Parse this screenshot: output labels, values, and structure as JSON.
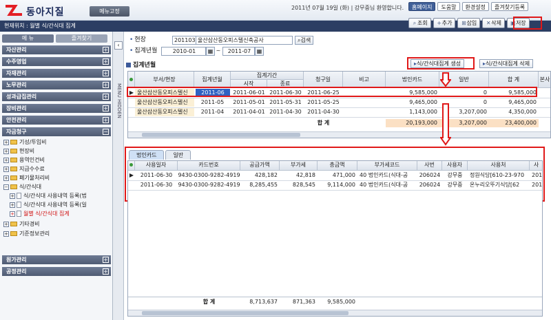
{
  "header": {
    "logo_text": "동아지질",
    "menu_fix_label": "메뉴고정",
    "greeting": "2011년 07월 19일 (화) | 강무중님 환영합니다.",
    "top_buttons": [
      "홈페이지",
      "도움말",
      "환경설정",
      "즐겨찾기등록"
    ]
  },
  "breadcrumb": "현재위치 : 월별 식/간식대 집계",
  "toolbar": {
    "buttons": [
      {
        "label": "조회",
        "icon": "search-icon"
      },
      {
        "label": "추가",
        "icon": "add-icon"
      },
      {
        "label": "삽입",
        "icon": "insert-icon"
      },
      {
        "label": "삭제",
        "icon": "delete-icon"
      },
      {
        "label": "저장",
        "icon": "save-icon"
      }
    ]
  },
  "sidebar": {
    "tab_menu": "메   뉴",
    "tab_fav": "즐겨찾기",
    "categories": [
      "자산관리",
      "수주영업",
      "자재관리",
      "노무관리",
      "성과급집관리",
      "장비관리",
      "안전관리",
      "자금청구"
    ],
    "tree": [
      {
        "label": "기성/투입비",
        "kind": "folder"
      },
      {
        "label": "현장비",
        "kind": "folder"
      },
      {
        "label": "용역인건비",
        "kind": "folder"
      },
      {
        "label": "지급수수료",
        "kind": "folder"
      },
      {
        "label": "폐기물처리비",
        "kind": "folder"
      },
      {
        "label": "식/간식대",
        "kind": "folder-open"
      },
      {
        "label": "식/간식대 사용내역 등록(법",
        "kind": "doc"
      },
      {
        "label": "식/간식대 사용내역 등록(일",
        "kind": "doc"
      },
      {
        "label": "월별 식/간식대 집계",
        "kind": "doc",
        "active": true
      },
      {
        "label": "기타경비",
        "kind": "folder"
      },
      {
        "label": "기준정보관리",
        "kind": "folder"
      }
    ],
    "bottom_categories": [
      "원가관리",
      "공정관리"
    ],
    "hidden_label": "MENU HIDDEN"
  },
  "search": {
    "site_label": "현장",
    "site_code": "201103210",
    "site_name": "울산삼산동오피스텔신축공사",
    "search_btn": "검색",
    "period_label": "집계년월",
    "from": "2010-01",
    "to": "2011-07",
    "tilde": "~"
  },
  "summary": {
    "title": "집계년월",
    "gen_btn": "식/간식대집계 생성",
    "del_btn": "식/간식대집계 삭제",
    "headers": {
      "dept": "부서/현장",
      "ym": "집계년월",
      "period": "집계기간",
      "start": "시작",
      "end": "종료",
      "claim": "청구일",
      "note": "비고",
      "card": "법인카드",
      "general": "일반",
      "total": "합 계",
      "extra": "본사"
    },
    "rows": [
      {
        "dept": "울산삼산동오피스텔신",
        "ym": "2011-06",
        "start": "2011-06-01",
        "end": "2011-06-30",
        "claim": "2011-06-25",
        "card": "9,585,000",
        "general": "0",
        "total": "9,585,000"
      },
      {
        "dept": "울산삼산동오피스텔신",
        "ym": "2011-05",
        "start": "2011-05-01",
        "end": "2011-05-31",
        "claim": "2011-05-25",
        "card": "9,465,000",
        "general": "0",
        "total": "9,465,000"
      },
      {
        "dept": "울산삼산동오피스텔신",
        "ym": "2011-04",
        "start": "2011-04-01",
        "end": "2011-04-30",
        "claim": "2011-04-30",
        "card": "1,143,000",
        "general": "3,207,000",
        "total": "4,350,000"
      }
    ],
    "sum_label": "합  계",
    "sum_card": "20,193,000",
    "sum_general": "3,207,000",
    "sum_total": "23,400,000"
  },
  "detail": {
    "tabs": [
      "법인카드",
      "일반"
    ],
    "headers": [
      "사용일자",
      "카드번호",
      "공급가액",
      "부가세",
      "총금액",
      "부가세코드",
      "사번",
      "사용자",
      "사용처",
      "사"
    ],
    "rows": [
      {
        "date": "2011-06-30",
        "card": "9430-0300-9282-4919",
        "supply": "428,182",
        "vat": "42,818",
        "total": "471,000",
        "code": "40 법인카드(식대-공",
        "emp": "206024",
        "user": "강무중",
        "place": "정원식당[610-23-970",
        "x": "201"
      },
      {
        "date": "2011-06-30",
        "card": "9430-0300-9282-4919",
        "supply": "8,285,455",
        "vat": "828,545",
        "total": "9,114,000",
        "code": "40 법인카드(식대-공",
        "emp": "206024",
        "user": "강무중",
        "place": "온누리오뚜기식당[62",
        "x": "201"
      }
    ],
    "sum_label": "합  계",
    "sum_supply": "8,713,637",
    "sum_vat": "871,363",
    "sum_total": "9,585,000"
  }
}
